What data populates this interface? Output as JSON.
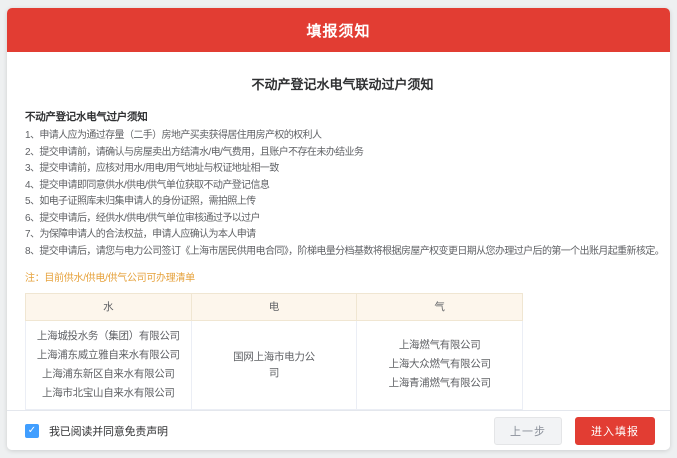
{
  "dialog": {
    "title": "填报须知",
    "subtitle": "不动产登记水电气联动过户须知"
  },
  "notice": {
    "section_title": "不动产登记水电气过户须知",
    "items": [
      "1、申请人应为通过存量（二手）房地产买卖获得居住用房产权的权利人",
      "2、提交申请前，请确认与房屋卖出方结清水/电/气费用，且账户不存在未办结业务",
      "3、提交申请前，应核对用水/用电/用气地址与权证地址相一致",
      "4、提交申请即同意供水/供电/供气单位获取不动产登记信息",
      "5、如电子证照库未归集申请人的身份证照，需拍照上传",
      "6、提交申请后，经供水/供电/供气单位审核通过予以过户",
      "7、为保障申请人的合法权益，申请人应确认为本人申请",
      "8、提交申请后，请您与电力公司签订《上海市居民供用电合同》，阶梯电量分档基数将根据房屋产权变更日期从您办理过户后的第一个出账月起重新核定。"
    ],
    "note": "注：目前供水/供电/供气公司可办理清单"
  },
  "table": {
    "headers": [
      "水",
      "电",
      "气"
    ],
    "water": [
      "上海城投水务（集团）有限公司",
      "上海浦东威立雅自来水有限公司",
      "上海浦东新区自来水有限公司",
      "上海市北宝山自来水有限公司"
    ],
    "electric": [
      "国网上海市电力公司"
    ],
    "gas": [
      "上海燃气有限公司",
      "上海大众燃气有限公司",
      "上海青浦燃气有限公司"
    ]
  },
  "footer": {
    "agree_label": "我已阅读并同意免责声明",
    "checkbox_checked": true,
    "check_icon": "✓",
    "prev_button": "上一步",
    "submit_button": "进入填报"
  },
  "colors": {
    "header_red": "#e23d33",
    "note_orange": "#e6a23c",
    "checkbox_blue": "#409eff",
    "table_header_bg": "#fdf6ec"
  }
}
